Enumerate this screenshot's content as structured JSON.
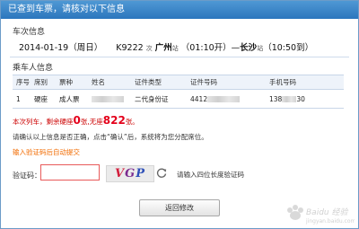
{
  "dialog": {
    "title": "已查到车票，请核对以下信息"
  },
  "train_info": {
    "heading": "车次信息",
    "date": "2014-01-19（周日）",
    "train_no": "K9222",
    "train_suffix": "次",
    "from_station": "广州",
    "station_suffix_1": "站",
    "depart_time": "（01:10开）",
    "separator": "—",
    "to_station": "长沙",
    "station_suffix_2": "站",
    "arrive_time": "（10:50到）"
  },
  "passenger_info": {
    "heading": "乘车人信息",
    "columns": [
      "序号",
      "席别",
      "票种",
      "姓名",
      "证件类型",
      "证件号码",
      "手机号码"
    ],
    "rows": [
      {
        "index": "1",
        "seat": "硬座",
        "ticket_type": "成人票",
        "id_type": "二代身份证",
        "id_prefix": "4412",
        "phone_prefix": "138",
        "phone_suffix": "30"
      }
    ]
  },
  "remaining": {
    "prefix": "本次列车，剩余硬座",
    "hard_seat": "0",
    "mid": "张,无座",
    "no_seat": "822",
    "suffix": "张。"
  },
  "confirm_text": "请确认以上信息是否正确，点击“确认”后，系统将为您分配席位。",
  "auto_submit_text": "输入验证码后自动提交",
  "verification": {
    "label": "验证码：",
    "value": "",
    "captcha_chars": [
      "V",
      "G",
      "P"
    ],
    "hint": "请输入四位长度验证码"
  },
  "buttons": {
    "back": "返回修改"
  },
  "watermark": {
    "text": "Baidu 经验",
    "url": "jingyan.baidu.com"
  },
  "colors": {
    "title_bar": "#3a86c8",
    "accent_red": "#e4001b",
    "orange": "#f26b00",
    "table_header": "#eef3fa"
  }
}
